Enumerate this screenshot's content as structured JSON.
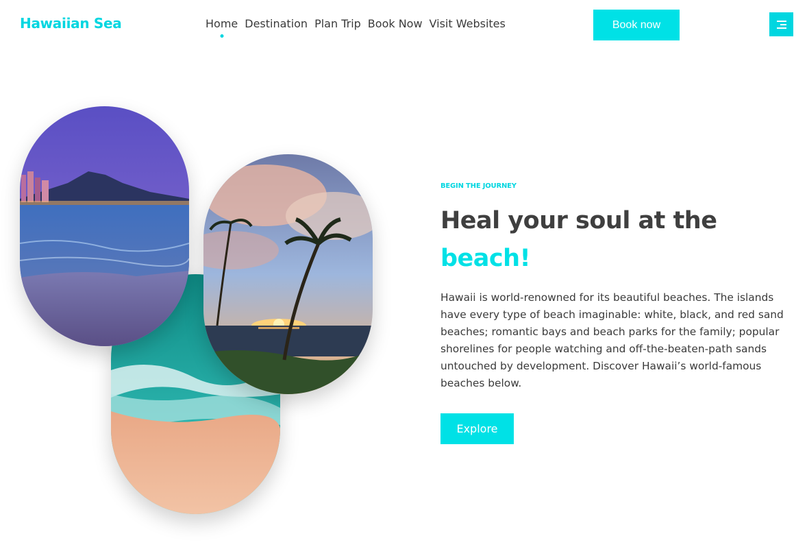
{
  "brand": {
    "name": "Hawaiian Sea",
    "accent_color": "#00d6e0"
  },
  "nav": {
    "items": [
      {
        "label": "Home",
        "active": true
      },
      {
        "label": "Destination",
        "active": false
      },
      {
        "label": "Plan Trip",
        "active": false
      },
      {
        "label": "Book Now",
        "active": false
      },
      {
        "label": "Visit Websites",
        "active": false
      }
    ]
  },
  "header": {
    "book_button_label": "Book now",
    "menu_icon": "hamburger-menu-icon"
  },
  "gallery": {
    "images": [
      {
        "name": "city-beach-dusk-image"
      },
      {
        "name": "aerial-beach-waves-image"
      },
      {
        "name": "palm-sunset-image"
      }
    ]
  },
  "hero": {
    "eyebrow": "BEGIN THE JOURNEY",
    "headline_line1": "Heal your soul at the",
    "headline_accent": "beach!",
    "description": "Hawaii is world-renowned for its beautiful beaches. The islands have every type of beach imaginable: white, black, and red sand beaches; romantic bays and beach parks for the family; popular shorelines for people watching and off-the-beaten-path sands untouched by development. Discover Hawaii’s world-famous beaches below.",
    "cta_label": "Explore"
  }
}
